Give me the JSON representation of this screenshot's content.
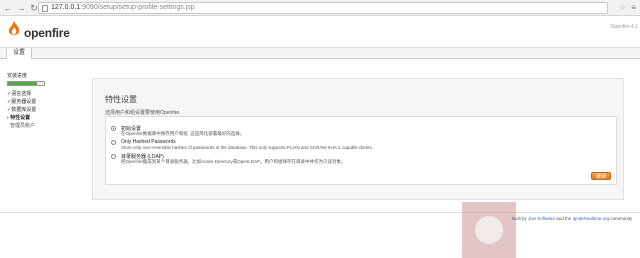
{
  "browser": {
    "url_host": "127.0.0.1",
    "url_path": ":9090/setup/setup-profile-settings.jsp",
    "back_icon": "back-arrow-icon",
    "forward_icon": "forward-arrow-icon",
    "reload_icon": "reload-icon"
  },
  "header": {
    "logo_text": "openfire",
    "version": "Openfire 4.1",
    "tab_label": "设置"
  },
  "sidebar": {
    "title": "安装进度",
    "progress_percent": 80,
    "items": [
      {
        "label": "语言选择",
        "state": "done"
      },
      {
        "label": "服务器设置",
        "state": "done"
      },
      {
        "label": "数据库设置",
        "state": "done"
      },
      {
        "label": "特性设置",
        "state": "current"
      },
      {
        "label": "管理员账户",
        "state": "pending"
      }
    ]
  },
  "panel": {
    "title": "特性设置",
    "description": "选择用户和组设置要使用Openfire.",
    "options": [
      {
        "label": "初始设置",
        "desc": "在Openfire数据库中保存用户和组. 这是简化部署最好的选择。",
        "selected": true
      },
      {
        "label": "Only Hashed Passwords",
        "desc": "Store only non-reversible hashes of passwords in the database. This only supports PLAIN and SCRAM-SHA-1 capable clients.",
        "selected": false
      },
      {
        "label": "目录服务器 (LDAP)",
        "desc": "把Openfire集成到某个目录服务器，比如Active Directory或OpenLDAP。用户和组保存在目录中并作为只读对象。",
        "selected": false
      }
    ],
    "continue_label": "继续"
  },
  "footer": {
    "prefix": "Built by ",
    "link1": "Jive Software",
    "middle": " and the ",
    "link2": "IgniteRealtime.org",
    "suffix": " community"
  },
  "colors": {
    "accent": "#e07a1c",
    "progress": "#4caf3e",
    "check": "#3c9a2e",
    "link": "#3a6fb0"
  }
}
